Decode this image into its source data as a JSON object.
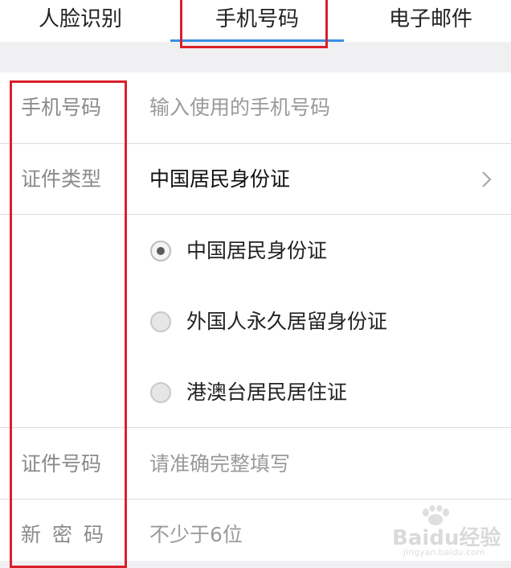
{
  "tabs": [
    {
      "label": "人脸识别",
      "active": false
    },
    {
      "label": "手机号码",
      "active": true
    },
    {
      "label": "电子邮件",
      "active": false
    }
  ],
  "form": {
    "phone": {
      "label": "手机号码",
      "placeholder": "输入使用的手机号码"
    },
    "id_type": {
      "label": "证件类型",
      "selected": "中国居民身份证",
      "options": [
        {
          "label": "中国居民身份证",
          "checked": true
        },
        {
          "label": "外国人永久居留身份证",
          "checked": false
        },
        {
          "label": "港澳台居民居住证",
          "checked": false
        }
      ]
    },
    "id_number": {
      "label": "证件号码",
      "placeholder": "请准确完整填写"
    },
    "new_password": {
      "label": "新密码",
      "placeholder": "不少于6位"
    }
  },
  "watermark": {
    "brand": "Baidu经验",
    "sub": "jingyan.baidu.com"
  },
  "colors": {
    "accent": "#3a8ee6",
    "highlight": "#d8202a"
  },
  "icons": {
    "chevron": "chevron-right-icon",
    "radio": "radio-icon",
    "paw": "paw-icon"
  }
}
